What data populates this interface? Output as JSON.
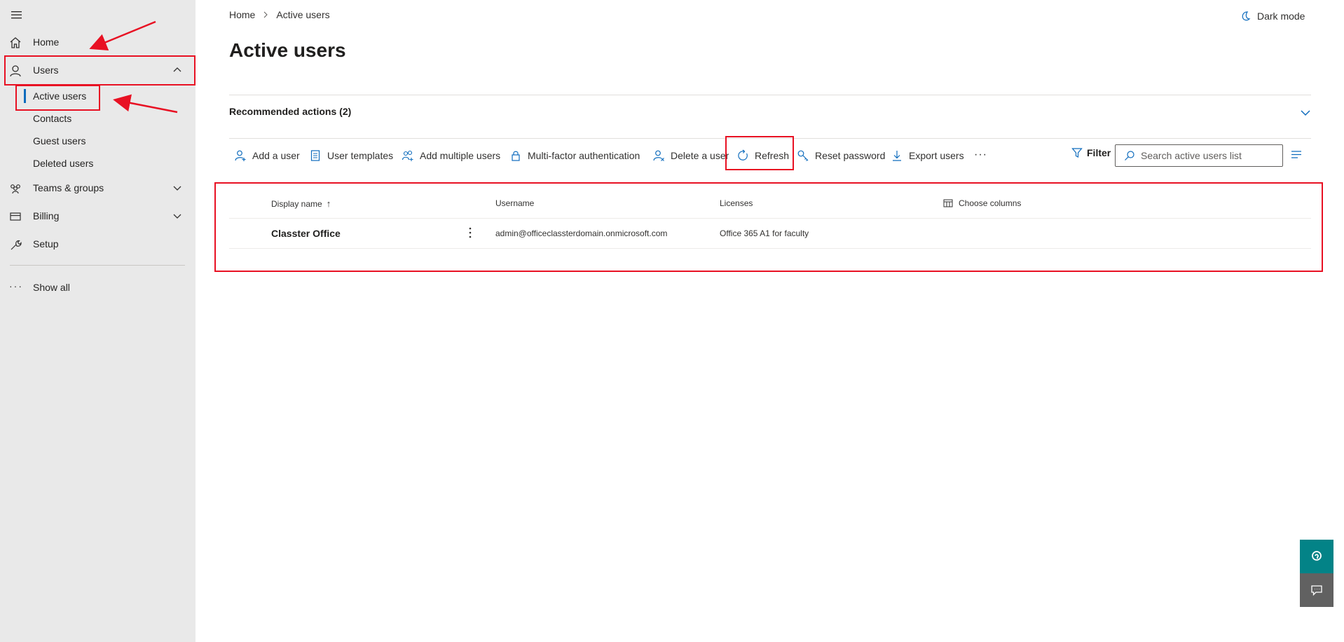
{
  "sidebar": {
    "items": [
      {
        "label": "Home",
        "icon": "home-icon"
      },
      {
        "label": "Users",
        "icon": "user-icon",
        "expanded": true
      },
      {
        "label": "Teams & groups",
        "icon": "teams-icon"
      },
      {
        "label": "Billing",
        "icon": "billing-icon"
      },
      {
        "label": "Setup",
        "icon": "wrench-icon"
      }
    ],
    "users_subitems": [
      {
        "label": "Active users",
        "selected": true
      },
      {
        "label": "Contacts"
      },
      {
        "label": "Guest users"
      },
      {
        "label": "Deleted users"
      }
    ],
    "show_all": "Show all"
  },
  "breadcrumb": {
    "home": "Home",
    "current": "Active users"
  },
  "dark_mode": "Dark mode",
  "page_title": "Active users",
  "recommended_actions": "Recommended actions (2)",
  "toolbar": {
    "add_user": "Add a user",
    "user_templates": "User templates",
    "add_multiple": "Add multiple users",
    "mfa": "Multi-factor authentication",
    "delete_user": "Delete a user",
    "refresh": "Refresh",
    "reset_password": "Reset password",
    "export_users": "Export users",
    "more": "···",
    "filter": "Filter",
    "search_placeholder": "Search active users list"
  },
  "table": {
    "columns": [
      "Display name",
      "Username",
      "Licenses"
    ],
    "sort_indicator": "↑",
    "choose_columns": "Choose columns",
    "rows": [
      {
        "display_name": "Classter Office",
        "username": "admin@officeclassterdomain.onmicrosoft.com",
        "licenses": "Office 365 A1 for faculty"
      }
    ]
  },
  "colors": {
    "accent": "#0f6cbd",
    "annotation": "#e81123",
    "help_button": "#038387",
    "feedback_button": "#616161"
  }
}
